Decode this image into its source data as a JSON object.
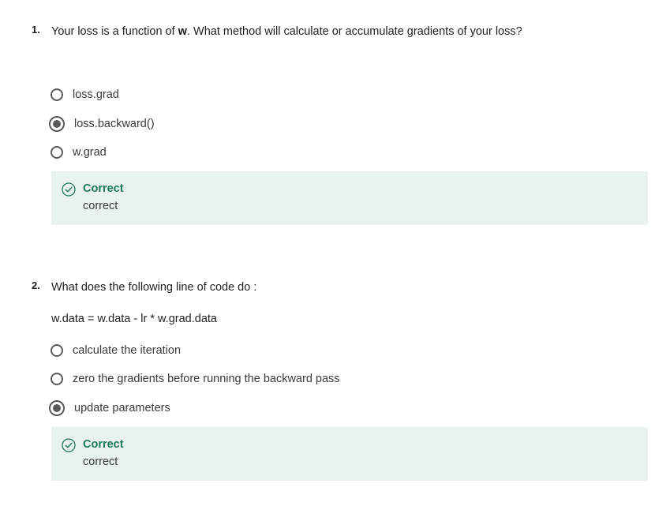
{
  "questions": [
    {
      "number": "1.",
      "text_before": "Your loss is a function of ",
      "text_bold": "w",
      "text_after": ". What method will calculate or accumulate gradients of your loss?",
      "options": [
        {
          "label": "loss.grad",
          "selected": false
        },
        {
          "label": "loss.backward()",
          "selected": true
        },
        {
          "label": "w.grad",
          "selected": false
        }
      ],
      "feedback": {
        "title": "Correct",
        "text": "correct",
        "icon": "check-circle-icon",
        "color": "#1d7a55"
      }
    },
    {
      "number": "2.",
      "text": "What does the following line of code do :",
      "code": "w.data = w.data - lr * w.grad.data",
      "options": [
        {
          "label": "calculate the iteration",
          "selected": false
        },
        {
          "label": "zero the gradients before running the backward pass",
          "selected": false
        },
        {
          "label": "update parameters",
          "selected": true
        }
      ],
      "feedback": {
        "title": "Correct",
        "text": "correct",
        "icon": "check-circle-icon",
        "color": "#1d7a55"
      }
    }
  ]
}
